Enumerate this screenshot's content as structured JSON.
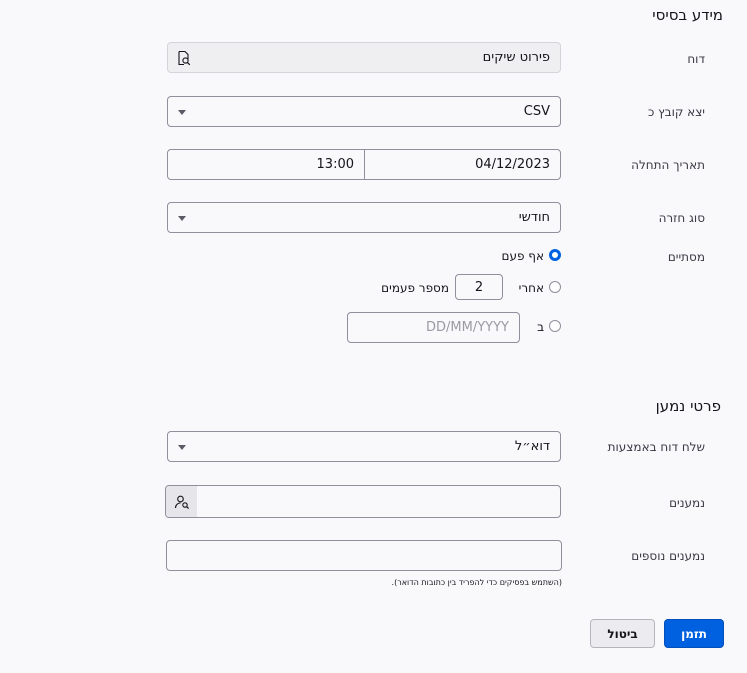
{
  "basic": {
    "title": "מידע בסיסי",
    "report_label": "דוח",
    "report_value": "פירוט שיקים",
    "export_label": "יצא קובץ כ",
    "export_value": "CSV",
    "start_label": "תאריך התחלה",
    "start_date": "04/12/2023",
    "start_time": "13:00",
    "recurrence_label": "סוג חזרה",
    "recurrence_value": "חודשי",
    "ends_label": "מסתיים",
    "end_never": "אף פעם",
    "end_after": "אחרי",
    "end_after_count": "2",
    "end_after_suffix": "מספר פעמים",
    "end_on": "ב",
    "end_on_placeholder": "DD/MM/YYYY"
  },
  "recipient": {
    "title": "פרטי נמען",
    "send_via_label": "שלח דוח באמצעות",
    "send_via_value": "דוא״ל",
    "recipients_label": "נמענים",
    "extra_label": "נמענים נוספים",
    "extra_note": "(השתמש בפסיקים כדי להפריד בין כתובות הדואר)."
  },
  "actions": {
    "cancel": "ביטול",
    "schedule": "תזמן"
  },
  "colors": {
    "accent": "#0061e0"
  }
}
